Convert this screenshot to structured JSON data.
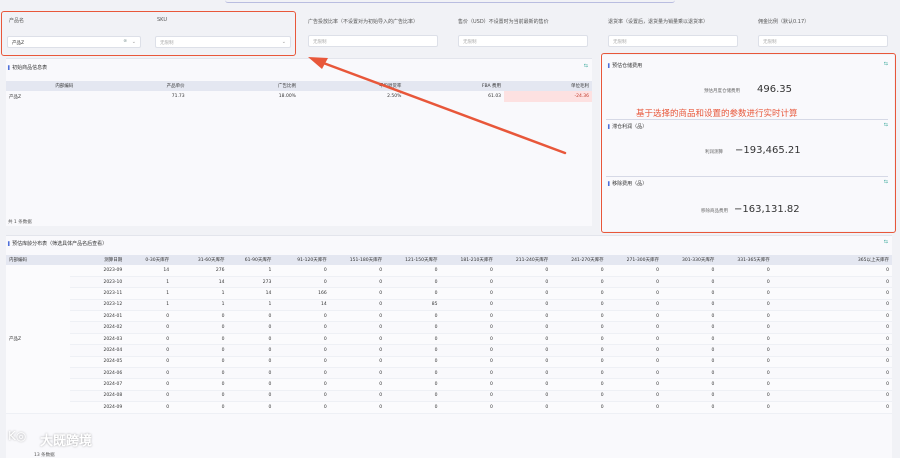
{
  "filters": {
    "product_name": {
      "label": "产品名",
      "value": "产品Z"
    },
    "sku": {
      "label": "SKU",
      "placeholder": "无限制"
    },
    "ad_ratio": {
      "label": "广告投放比率（不设置对为初始导入的广告比率）",
      "placeholder": "无限制"
    },
    "price": {
      "label": "售价（USD）不设置时为当前最新的售价",
      "placeholder": "无限制"
    },
    "return_rate": {
      "label": "退货率（设置后，退货量为销量乘以退货率）",
      "placeholder": "无限制"
    },
    "commission": {
      "label": "佣金比例（默认0.17）",
      "placeholder": "无限制"
    }
  },
  "product_table": {
    "title": "初始商品信息表",
    "columns": [
      "内部编码",
      "产品单价",
      "广告比例",
      "平均退货率",
      "FBA 费用",
      "单位毛利"
    ],
    "rows": [
      {
        "code": "产品Z",
        "price": "71.73",
        "ad": "18.00%",
        "ret": "2.50%",
        "fba": "61.03",
        "margin": "-24.36"
      }
    ],
    "footer": "共 1 条数据"
  },
  "kpis": {
    "storage": {
      "title": "预估仓储费用",
      "label": "预估月度仓储费用",
      "value": "496.35"
    },
    "profit": {
      "title": "滞仓利润（品）",
      "label": "利润测算",
      "value": "−193,465.21"
    },
    "removal": {
      "title": "移除费用（品）",
      "label": "移除商品费用",
      "value": "−163,131.82"
    }
  },
  "annotation": "基于选择的商品和设置的参数进行实时计算",
  "inventory_table": {
    "title": "预估库龄分布表（筛选具体产品名后查看）",
    "columns": [
      "内部编码",
      "测算日期",
      "0-30天库存",
      "31-60天库存",
      "61-90天库存",
      "91-120天库存",
      "151-180天库存",
      "121-150天库存",
      "181-210天库存",
      "211-240天库存",
      "241-270天库存",
      "271-300天库存",
      "301-330天库存",
      "331-365天库存",
      "365以上天库存"
    ],
    "code": "产品Z",
    "rows": [
      {
        "date": "2023-09",
        "v": [
          "14",
          "276",
          "1",
          "0",
          "0",
          "0",
          "0",
          "0",
          "0",
          "0",
          "0",
          "0",
          "0"
        ]
      },
      {
        "date": "2023-10",
        "v": [
          "1",
          "14",
          "273",
          "0",
          "0",
          "0",
          "0",
          "0",
          "0",
          "0",
          "0",
          "0",
          "0"
        ]
      },
      {
        "date": "2023-11",
        "v": [
          "1",
          "1",
          "14",
          "166",
          "0",
          "0",
          "0",
          "0",
          "0",
          "0",
          "0",
          "0",
          "0"
        ]
      },
      {
        "date": "2023-12",
        "v": [
          "1",
          "1",
          "1",
          "14",
          "0",
          "85",
          "0",
          "0",
          "0",
          "0",
          "0",
          "0",
          "0"
        ]
      },
      {
        "date": "2024-01",
        "v": [
          "0",
          "0",
          "0",
          "0",
          "0",
          "0",
          "0",
          "0",
          "0",
          "0",
          "0",
          "0",
          "0"
        ]
      },
      {
        "date": "2024-02",
        "v": [
          "0",
          "0",
          "0",
          "0",
          "0",
          "0",
          "0",
          "0",
          "0",
          "0",
          "0",
          "0",
          "0"
        ]
      },
      {
        "date": "2024-03",
        "v": [
          "0",
          "0",
          "0",
          "0",
          "0",
          "0",
          "0",
          "0",
          "0",
          "0",
          "0",
          "0",
          "0"
        ]
      },
      {
        "date": "2024-04",
        "v": [
          "0",
          "0",
          "0",
          "0",
          "0",
          "0",
          "0",
          "0",
          "0",
          "0",
          "0",
          "0",
          "0"
        ]
      },
      {
        "date": "2024-05",
        "v": [
          "0",
          "0",
          "0",
          "0",
          "0",
          "0",
          "0",
          "0",
          "0",
          "0",
          "0",
          "0",
          "0"
        ]
      },
      {
        "date": "2024-06",
        "v": [
          "0",
          "0",
          "0",
          "0",
          "0",
          "0",
          "0",
          "0",
          "0",
          "0",
          "0",
          "0",
          "0"
        ]
      },
      {
        "date": "2024-07",
        "v": [
          "0",
          "0",
          "0",
          "0",
          "0",
          "0",
          "0",
          "0",
          "0",
          "0",
          "0",
          "0",
          "0"
        ]
      },
      {
        "date": "2024-08",
        "v": [
          "0",
          "0",
          "0",
          "0",
          "0",
          "0",
          "0",
          "0",
          "0",
          "0",
          "0",
          "0",
          "0"
        ]
      },
      {
        "date": "2024-09",
        "v": [
          "0",
          "0",
          "0",
          "0",
          "0",
          "0",
          "0",
          "0",
          "0",
          "0",
          "0",
          "0",
          "0"
        ]
      }
    ],
    "footer": "13 条数据"
  },
  "watermark": "大既跨境",
  "colors": {
    "accent": "#4e6fd9",
    "annotation": "#e8573a",
    "header_bg": "#e4e7f1",
    "negative_bg": "#fde1e1"
  },
  "icons": {
    "panel_action": "table-export-icon",
    "select_chevron": "chevron-down-icon"
  }
}
